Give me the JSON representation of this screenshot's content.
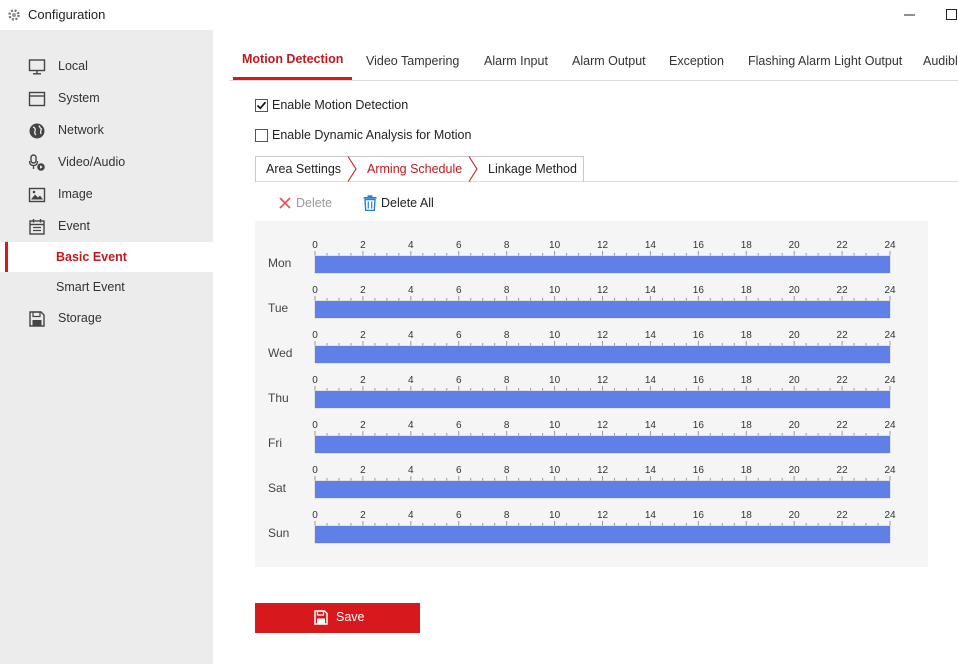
{
  "window": {
    "title": "Configuration",
    "icons": {
      "app": "gear-icon",
      "minimize": "minimize-icon",
      "maximize": "maximize-icon"
    }
  },
  "sidebar": {
    "items": [
      {
        "label": "Local",
        "icon": "monitor-icon"
      },
      {
        "label": "System",
        "icon": "system-window-icon"
      },
      {
        "label": "Network",
        "icon": "globe-icon"
      },
      {
        "label": "Video/Audio",
        "icon": "microphone-camera-icon"
      },
      {
        "label": "Image",
        "icon": "image-icon"
      },
      {
        "label": "Event",
        "icon": "calendar-icon"
      },
      {
        "label": "Basic Event",
        "sub": true,
        "active": true
      },
      {
        "label": "Smart Event",
        "sub": true
      },
      {
        "label": "Storage",
        "icon": "floppy-disk-icon"
      }
    ],
    "active_color": "#c8161d"
  },
  "tabs": {
    "items": [
      "Motion Detection",
      "Video Tampering",
      "Alarm Input",
      "Alarm Output",
      "Exception",
      "Flashing Alarm Light Output",
      "Audibl"
    ],
    "active": "Motion Detection"
  },
  "options": {
    "enable_motion": {
      "label": "Enable Motion Detection",
      "checked": true
    },
    "enable_dynamic": {
      "label": "Enable Dynamic Analysis for Motion",
      "checked": false
    }
  },
  "subtabs": {
    "items": [
      "Area Settings",
      "Arming Schedule",
      "Linkage Method"
    ],
    "active": "Arming Schedule"
  },
  "toolbar": {
    "delete": {
      "label": "Delete",
      "icon": "close-x-icon",
      "enabled": false
    },
    "delete_all": {
      "label": "Delete All",
      "icon": "trash-icon"
    }
  },
  "schedule": {
    "days": [
      "Mon",
      "Tue",
      "Wed",
      "Thu",
      "Fri",
      "Sat",
      "Sun"
    ],
    "hour_labels": [
      "0",
      "2",
      "4",
      "6",
      "8",
      "10",
      "12",
      "14",
      "16",
      "18",
      "20",
      "22",
      "24"
    ],
    "armed_hours": [
      [
        0,
        24
      ],
      [
        0,
        24
      ],
      [
        0,
        24
      ],
      [
        0,
        24
      ],
      [
        0,
        24
      ],
      [
        0,
        24
      ],
      [
        0,
        24
      ]
    ],
    "bar_color": "#6080e8"
  },
  "actions": {
    "save": {
      "label": "Save",
      "icon": "save-icon"
    }
  },
  "colors": {
    "accent": "#d7191e",
    "sidebar_bg": "#ececec",
    "schedule_bg": "#f5f5f5"
  }
}
